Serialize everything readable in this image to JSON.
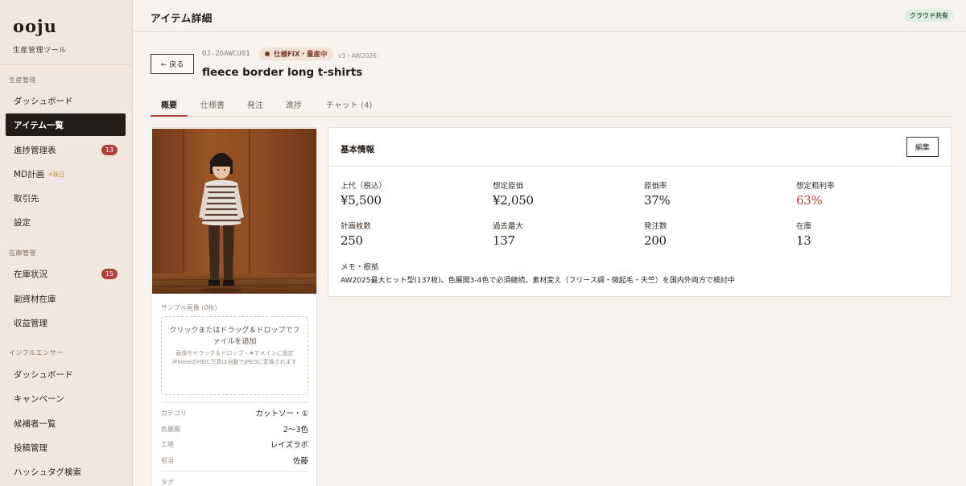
{
  "app": {
    "logo": "ooju",
    "subtitle": "生産管理ツール"
  },
  "sidebar": {
    "sections": [
      {
        "title": "生産管理"
      },
      {
        "title": "在庫管理"
      },
      {
        "title": "インフルエンサー"
      }
    ],
    "items": [
      {
        "label": "ダッシュボード"
      },
      {
        "label": "アイテム一覧"
      },
      {
        "label": "進捗管理表",
        "badge": "13"
      },
      {
        "label": "MD計画",
        "note": "※後日"
      },
      {
        "label": "取引先"
      },
      {
        "label": "設定"
      },
      {
        "label": "在庫状況",
        "badge": "15"
      },
      {
        "label": "副資材在庫"
      },
      {
        "label": "収益管理"
      },
      {
        "label": "ダッシュボード"
      },
      {
        "label": "キャンペーン"
      },
      {
        "label": "候補者一覧"
      },
      {
        "label": "投稿管理"
      },
      {
        "label": "ハッシュタグ検索"
      }
    ]
  },
  "header": {
    "title": "アイテム詳細",
    "cloud_badge": "クラウド共有"
  },
  "item": {
    "back_label": "← 戻る",
    "code": "OJ-26AWCU01",
    "status": "仕様FIX・量産中",
    "version": "v3・AW2026",
    "name": "fleece border long t-shirts"
  },
  "tabs": [
    {
      "label": "概要"
    },
    {
      "label": "仕様書"
    },
    {
      "label": "発注"
    },
    {
      "label": "進捗"
    },
    {
      "label": "チャット (4)"
    }
  ],
  "left_panel": {
    "sample_label": "サンプル画像 (0枚)",
    "dropzone_main": "クリックまたはドラッグ＆ドロップでファイルを追加",
    "dropzone_sub1": "画像をドラッグ＆ドロップ・★でメインに設定",
    "dropzone_sub2": "iPhoneのHEIC写真は自動でJPEGに変換されます",
    "specs": [
      {
        "key": "カテゴリ",
        "value": "カットソー・①"
      },
      {
        "key": "色展開",
        "value": "2〜3色"
      },
      {
        "key": "工場",
        "value": "レイズラボ"
      },
      {
        "key": "担当",
        "value": "佐藤"
      }
    ],
    "tag_label": "タグ"
  },
  "basic_info": {
    "title": "基本情報",
    "edit_label": "編集",
    "metrics": [
      {
        "label": "上代（税込）",
        "value": "¥5,500"
      },
      {
        "label": "想定原価",
        "value": "¥2,050"
      },
      {
        "label": "原価率",
        "value": "37%"
      },
      {
        "label": "想定粗利率",
        "value": "63%"
      },
      {
        "label": "計画枚数",
        "value": "250"
      },
      {
        "label": "過去最大",
        "value": "137"
      },
      {
        "label": "発注数",
        "value": "200"
      },
      {
        "label": "在庫",
        "value": "13"
      }
    ],
    "memo_label": "メモ・根拠",
    "memo_text": "AW2025最大ヒット型(137枚)。色展開3-4色で必須継続。素材変え（フリース調・微起毛・天竺）を国内外両方で検討中"
  },
  "colors": {
    "accent": "#b0413a",
    "sidebar_active": "#231d19",
    "status_chip": "#f1e1d6",
    "cloud_badge": "#e1eee3"
  }
}
